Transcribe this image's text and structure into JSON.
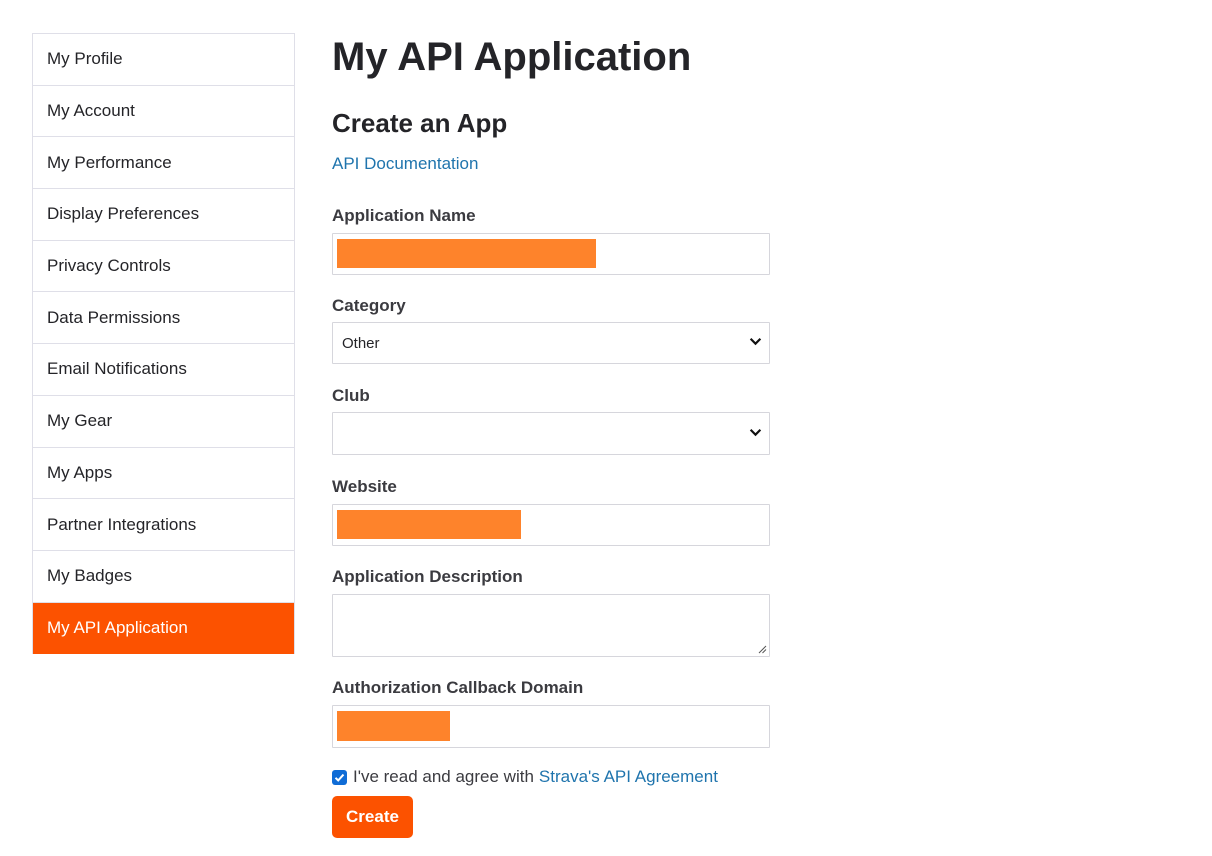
{
  "sidebar": {
    "items": [
      {
        "label": "My Profile"
      },
      {
        "label": "My Account"
      },
      {
        "label": "My Performance"
      },
      {
        "label": "Display Preferences"
      },
      {
        "label": "Privacy Controls"
      },
      {
        "label": "Data Permissions"
      },
      {
        "label": "Email Notifications"
      },
      {
        "label": "My Gear"
      },
      {
        "label": "My Apps"
      },
      {
        "label": "Partner Integrations"
      },
      {
        "label": "My Badges"
      },
      {
        "label": "My API Application"
      }
    ],
    "active_index": 11
  },
  "main": {
    "page_title": "My API Application",
    "section_title": "Create an App",
    "doc_link": "API Documentation"
  },
  "form": {
    "application_name": {
      "label": "Application Name",
      "value": ""
    },
    "category": {
      "label": "Category",
      "value": "Other"
    },
    "club": {
      "label": "Club",
      "value": ""
    },
    "website": {
      "label": "Website",
      "value": ""
    },
    "description": {
      "label": "Application Description",
      "value": ""
    },
    "callback_domain": {
      "label": "Authorization Callback Domain",
      "value": ""
    },
    "agreement": {
      "checked": true,
      "text": "I've read and agree with",
      "link": "Strava's API Agreement"
    },
    "create_label": "Create"
  },
  "colors": {
    "brand": "#fc5200",
    "link": "#1f74ad",
    "redaction": "#fe832b",
    "checkbox": "#0f6cd6"
  }
}
